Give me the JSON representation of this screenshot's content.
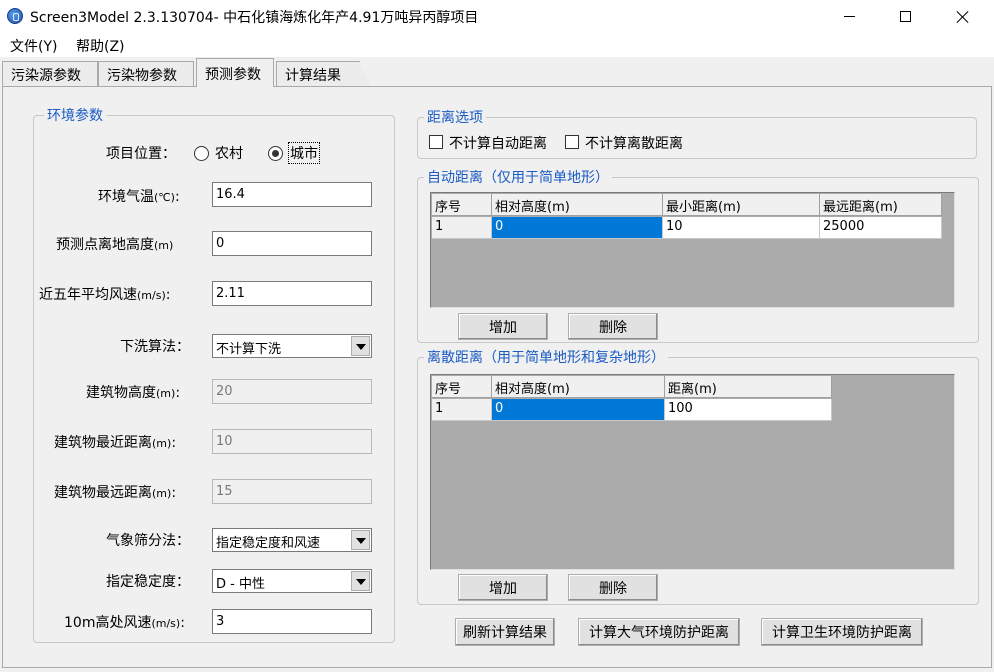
{
  "window": {
    "title": "Screen3Model 2.3.130704- 中石化镇海炼化年产4.91万吨异丙醇项目"
  },
  "menu": {
    "file": "文件(Y)",
    "help": "帮助(Z)"
  },
  "tabs": [
    {
      "label": "污染源参数"
    },
    {
      "label": "污染物参数"
    },
    {
      "label": "预测参数"
    },
    {
      "label": "计算结果"
    }
  ],
  "env": {
    "legend": "环境参数",
    "location_label": "项目位置：",
    "rural_label": "农村",
    "urban_label": "城市",
    "location_selected": "城市",
    "temp_label": "环境气温",
    "temp_unit": "(℃)",
    "temp_colon": ":",
    "temp_value": "16.4",
    "height_label": "预测点离地高度",
    "height_unit": "(m)",
    "height_value": "0",
    "wind_label": "近五年平均风速",
    "wind_unit": "(m/s)",
    "wind_colon": ":",
    "wind_value": "2.11",
    "downwash_label": "下洗算法：",
    "downwash_value": "不计算下洗",
    "bldg_height_label": "建筑物高度",
    "bldg_height_unit": "(m)",
    "bldg_height_colon": ":",
    "bldg_height_value": "20",
    "bldg_min_label": "建筑物最近距离",
    "bldg_min_unit": "(m)",
    "bldg_min_colon": ":",
    "bldg_min_value": "10",
    "bldg_max_label": "建筑物最远距离",
    "bldg_max_unit": "(m)",
    "bldg_max_colon": ":",
    "bldg_max_value": "15",
    "met_label": "气象筛分法：",
    "met_value": "指定稳定度和风速",
    "stability_label": "指定稳定度：",
    "stability_value": "D - 中性",
    "wind10_label": "10m高处风速",
    "wind10_unit": "(m/s)",
    "wind10_colon": ":",
    "wind10_value": "3"
  },
  "dist_options": {
    "legend": "距离选项",
    "no_auto_label": "不计算自动距离",
    "no_discrete_label": "不计算离散距离"
  },
  "auto_dist": {
    "legend": "自动距离（仅用于简单地形）",
    "headers": [
      "序号",
      "相对高度(m)",
      "最小距离(m)",
      "最远距离(m)"
    ],
    "rows": [
      [
        "1",
        "0",
        "10",
        "25000"
      ]
    ],
    "add_label": "增加",
    "delete_label": "删除"
  },
  "discrete_dist": {
    "legend": "离散距离（用于简单地形和复杂地形）",
    "headers": [
      "序号",
      "相对高度(m)",
      "距离(m)"
    ],
    "rows": [
      [
        "1",
        "0",
        "100"
      ]
    ],
    "add_label": "增加",
    "delete_label": "删除"
  },
  "actions": {
    "refresh_label": "刷新计算结果",
    "air_protect_label": "计算大气环境防护距离",
    "health_protect_label": "计算卫生环境防护距离"
  },
  "colors": {
    "accent": "#0078d7",
    "legend_text": "#1a5bc4"
  }
}
